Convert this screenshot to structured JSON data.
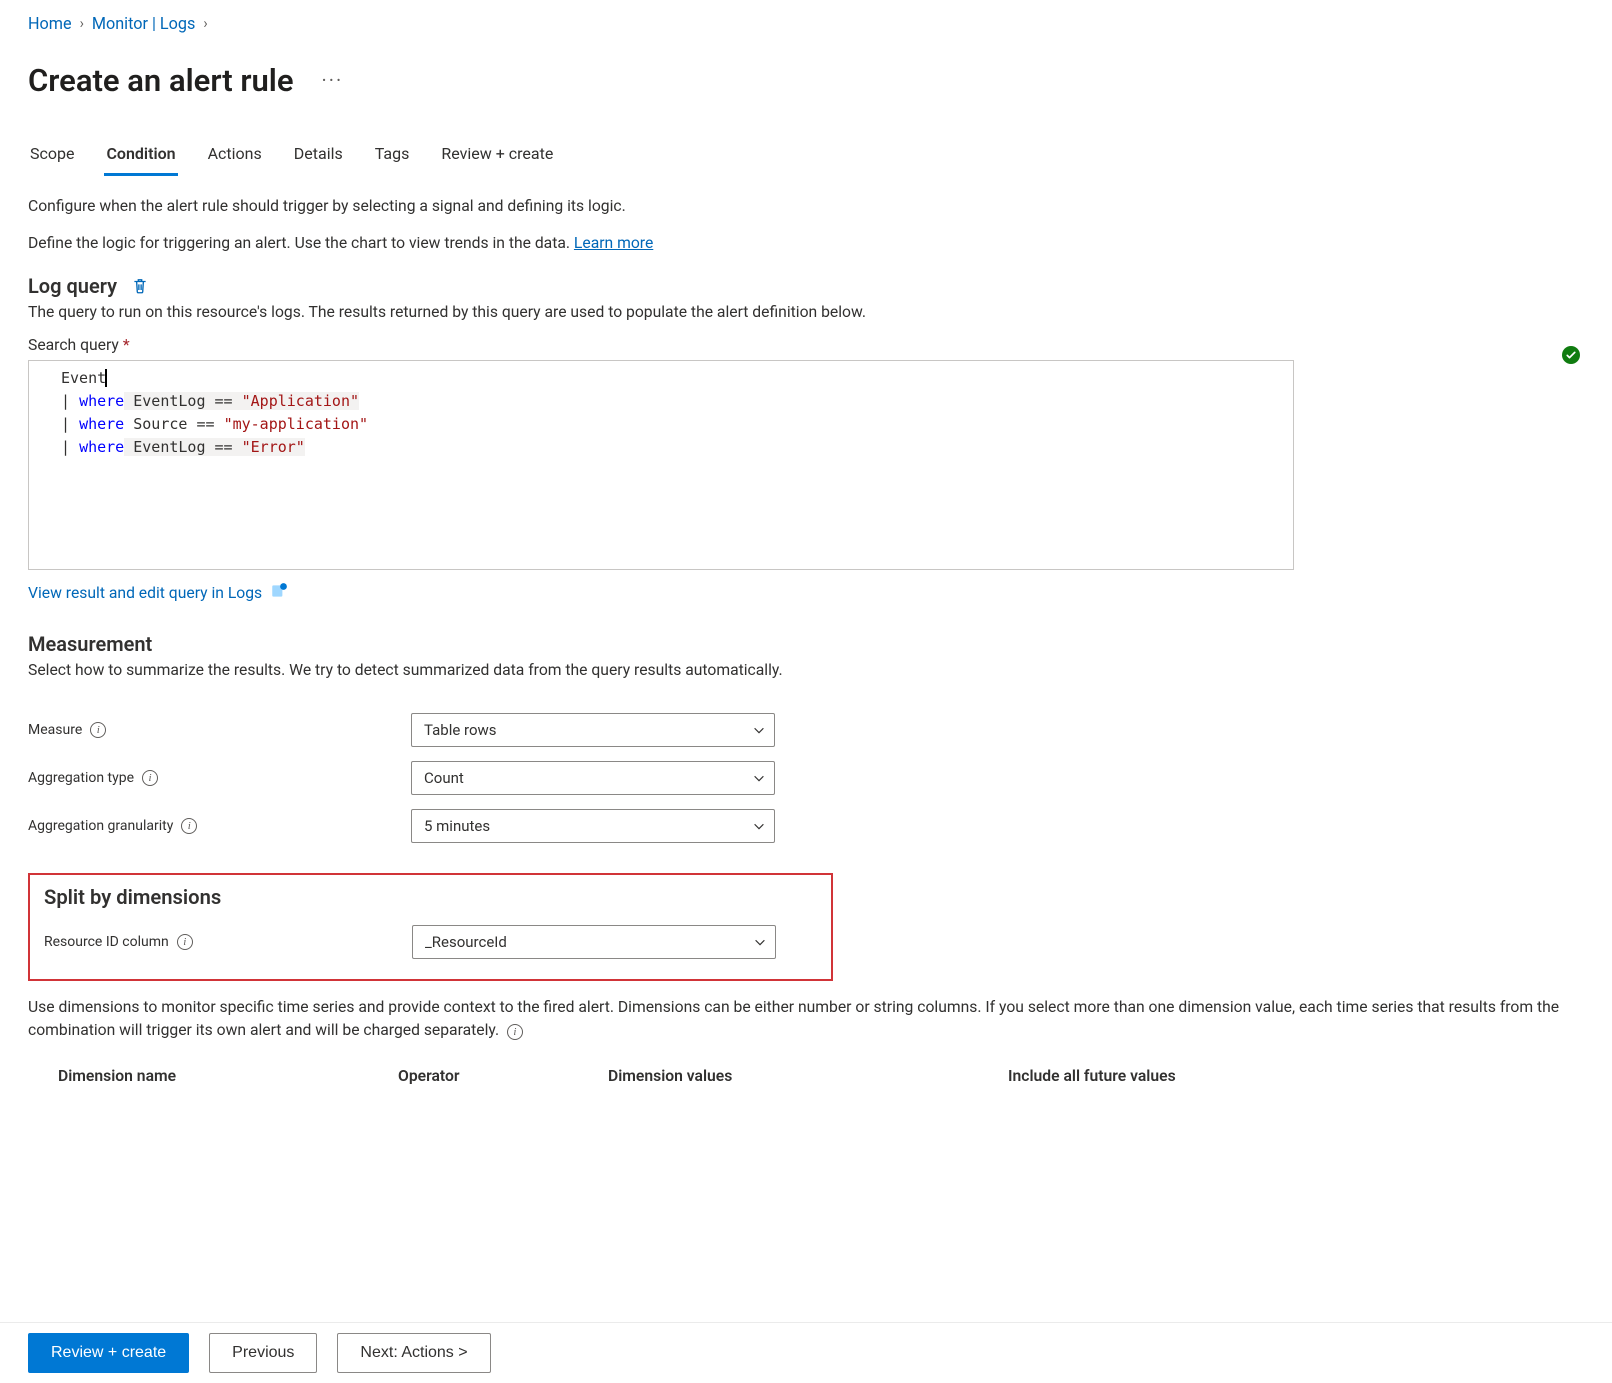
{
  "breadcrumb": {
    "items": [
      "Home",
      "Monitor | Logs"
    ],
    "trailing": true
  },
  "page_title": "Create an alert rule",
  "more_button_glyph": "···",
  "tabs": [
    {
      "label": "Scope",
      "active": false
    },
    {
      "label": "Condition",
      "active": true
    },
    {
      "label": "Actions",
      "active": false
    },
    {
      "label": "Details",
      "active": false
    },
    {
      "label": "Tags",
      "active": false
    },
    {
      "label": "Review + create",
      "active": false
    }
  ],
  "intro_line1": "Configure when the alert rule should trigger by selecting a signal and defining its logic.",
  "intro_line2_pre": "Define the logic for triggering an alert. Use the chart to view trends in the data. ",
  "intro_learn_more": "Learn more",
  "log_query": {
    "heading": "Log query",
    "desc": "The query to run on this resource's logs. The results returned by this query are used to populate the alert definition below.",
    "search_label": "Search query",
    "editor_lines": [
      {
        "tokens": [
          {
            "t": "Event",
            "c": "plain"
          }
        ]
      },
      {
        "tokens": [
          {
            "t": "| ",
            "c": "plain"
          },
          {
            "t": "where",
            "c": "kw"
          },
          {
            "t": " EventLog == ",
            "c": "plain",
            "hl": true
          },
          {
            "t": "\"Application\"",
            "c": "str",
            "hl": true
          }
        ]
      },
      {
        "tokens": [
          {
            "t": "| ",
            "c": "plain"
          },
          {
            "t": "where",
            "c": "kw"
          },
          {
            "t": " Source == ",
            "c": "plain"
          },
          {
            "t": "\"my-application\"",
            "c": "str"
          }
        ]
      },
      {
        "tokens": [
          {
            "t": "| ",
            "c": "plain"
          },
          {
            "t": "where",
            "c": "kw"
          },
          {
            "t": " EventLog == ",
            "c": "plain",
            "hl": true
          },
          {
            "t": "\"Error\"",
            "c": "str",
            "hl": true
          }
        ]
      }
    ],
    "validated": true,
    "view_link": "View result and edit query in Logs"
  },
  "measurement": {
    "heading": "Measurement",
    "desc": "Select how to summarize the results. We try to detect summarized data from the query results automatically.",
    "measure_label": "Measure",
    "measure_value": "Table rows",
    "agg_type_label": "Aggregation type",
    "agg_type_value": "Count",
    "agg_gran_label": "Aggregation granularity",
    "agg_gran_value": "5 minutes"
  },
  "split": {
    "heading": "Split by dimensions",
    "resource_label": "Resource ID column",
    "resource_value": "_ResourceId",
    "note_pre": "Use dimensions to monitor specific time series and provide context to the fired alert. Dimensions can be either number or string columns. If you select more than one dimension value, each time series that results from the combination will trigger its own alert and will be charged separately.",
    "table_headers": {
      "name": "Dimension name",
      "operator": "Operator",
      "values": "Dimension values",
      "include_future": "Include all future values"
    }
  },
  "footer": {
    "review": "Review + create",
    "previous": "Previous",
    "next": "Next: Actions >"
  }
}
